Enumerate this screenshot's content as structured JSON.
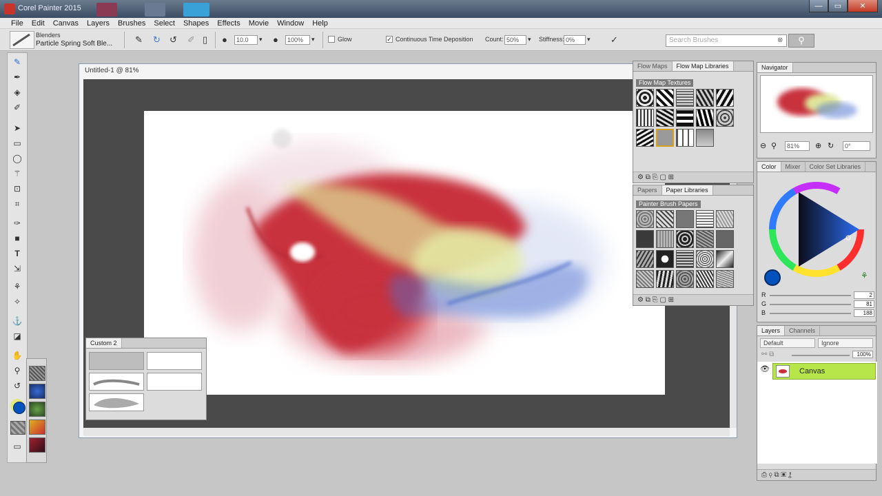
{
  "window": {
    "title": "Corel Painter 2015",
    "min": "—",
    "max": "▭",
    "close": "✕"
  },
  "menu": [
    "File",
    "Edit",
    "Canvas",
    "Layers",
    "Brushes",
    "Select",
    "Shapes",
    "Effects",
    "Movie",
    "Window",
    "Help"
  ],
  "property_bar": {
    "brush_category": "Blenders",
    "brush_variant": "Particle Spring Soft Ble...",
    "size_value": "10.0",
    "opacity_value": "100%",
    "glow_label": "Glow",
    "continuous_label": "Continuous Time Deposition",
    "count_label": "Count:",
    "count_value": "50%",
    "stiffness_label": "Stiffness:",
    "stiffness_value": "0%",
    "search_placeholder": "Search Brushes"
  },
  "document": {
    "title": "Untitled-1 @ 81%"
  },
  "custom_palette": {
    "tab": "Custom 2"
  },
  "flow_map_panel": {
    "tabs": [
      "Flow Maps",
      "Flow Map Libraries"
    ],
    "section": "Flow Map Textures"
  },
  "paper_panel": {
    "tabs": [
      "Papers",
      "Paper Libraries"
    ],
    "section": "Painter Brush Papers"
  },
  "navigator": {
    "tab": "Navigator",
    "zoom": "81%",
    "rotation": "0°"
  },
  "color": {
    "tabs": [
      "Color",
      "Mixer",
      "Color Set Libraries"
    ],
    "r_label": "R",
    "r_value": "2",
    "g_label": "G",
    "g_value": "81",
    "b_label": "B",
    "b_value": "188",
    "main_color": "#0251bc"
  },
  "layers": {
    "tabs": [
      "Layers",
      "Channels"
    ],
    "composite_method": "Default",
    "composite_depth": "Ignore",
    "opacity": "100%",
    "layer_name": "Canvas"
  },
  "colors": {
    "layer_selected": "#b7e64b",
    "accent_red": "#c8303c",
    "accent_blue": "#4b6fd0",
    "accent_yellow": "#dfe69a"
  }
}
